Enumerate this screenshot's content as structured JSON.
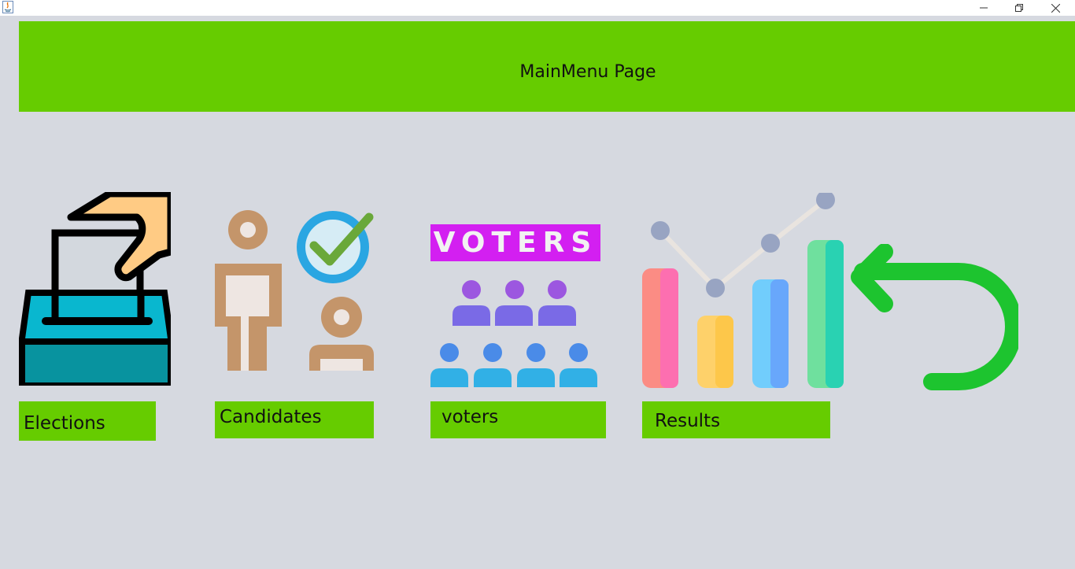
{
  "window": {
    "title": "",
    "controls": [
      "minimize",
      "restore",
      "close"
    ]
  },
  "header": {
    "title": "MainMenu Page"
  },
  "menu": {
    "elections": {
      "label": "Elections",
      "icon": "ballot-box-icon"
    },
    "candidates": {
      "label": "Candidates",
      "icon": "candidates-icon"
    },
    "voters": {
      "label": "voters",
      "icon": "voters-icon",
      "banner_text": "VOTERS"
    },
    "results": {
      "label": "Results",
      "icon": "results-chart-icon"
    }
  },
  "back": {
    "icon": "back-arrow-icon"
  },
  "colors": {
    "background": "#d6d9e0",
    "accent_green": "#66cc00",
    "back_arrow": "#1dc42f",
    "voters_banner": "#d31ff1"
  }
}
